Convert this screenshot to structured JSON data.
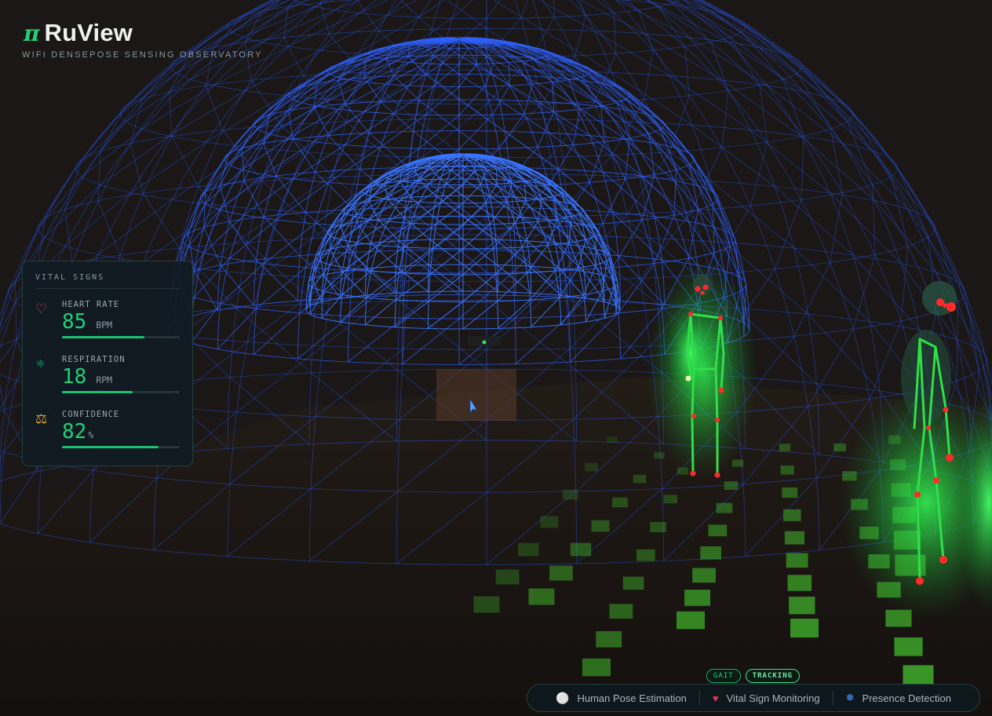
{
  "brand": {
    "symbol": "π",
    "name": "RuView",
    "subtitle": "WIFI DENSEPOSE SENSING OBSERVATORY",
    "accent_color": "#1fd079"
  },
  "vitals": {
    "title": "VITAL SIGNS",
    "items": [
      {
        "icon": "heart-icon",
        "label": "HEART RATE",
        "value": "85",
        "unit": "BPM",
        "level": 0.7,
        "icon_color": "#e0405a"
      },
      {
        "icon": "respiration-icon",
        "label": "RESPIRATION",
        "value": "18",
        "unit": "RPM",
        "level": 0.6,
        "icon_color": "#1fd079"
      },
      {
        "icon": "scale-icon",
        "label": "CONFIDENCE",
        "value": "82",
        "unit": "%",
        "level": 0.82,
        "icon_color": "#e3a23a"
      }
    ]
  },
  "status_badges": [
    {
      "label": "GAIT",
      "active": false
    },
    {
      "label": "TRACKING",
      "active": true
    }
  ],
  "features": [
    {
      "icon": "pose-icon",
      "label": "Human Pose Estimation"
    },
    {
      "icon": "heart-icon",
      "label": "Vital Sign Monitoring"
    },
    {
      "icon": "presence-icon",
      "label": "Presence Detection"
    }
  ],
  "colors": {
    "background": "#141110",
    "wireframe": "#2a5cff",
    "skeleton": "#22e04a",
    "joint": "#ff2a2a"
  }
}
